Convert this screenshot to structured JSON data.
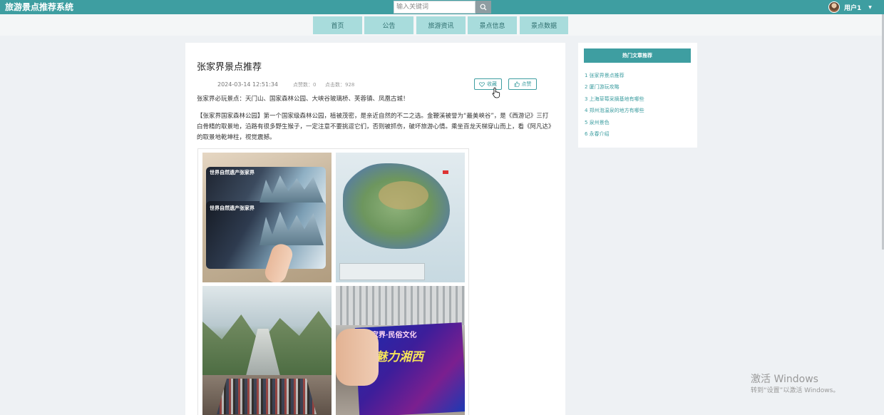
{
  "app": {
    "title": "旅游景点推荐系统"
  },
  "search": {
    "placeholder": "输入关键词"
  },
  "user": {
    "name": "用户1"
  },
  "nav": {
    "items": [
      "首页",
      "公告",
      "旅游资讯",
      "景点信息",
      "景点数据"
    ]
  },
  "article": {
    "title": "张家界景点推荐",
    "time": "2024-03-14 12:51:34",
    "favorites": "点赞数：0",
    "clicks": "点击数：928",
    "fav_button": "收藏",
    "like_button": "点赞",
    "intro": "张家界必玩景点：天门山、国家森林公园、大峡谷玻璃桥、芙蓉镇、凤凰古城！",
    "para2": "【张家界国家森林公园】第一个国家级森林公园，植被茂密，是亲近自然的不二之选。金鞭溪被誉为“最美峡谷”，是《西游记》三打白骨精的取景地，沿路有很多野生猴子，一定注意不要挑逗它们，否则被抓伤，破坏旅游心情。乘坐百龙天梯穿山而上，看《阿凡达》的取景地乾坤柱，视觉震撼。"
  },
  "gallery": {
    "ticket_text": "世界自然遗产张家界",
    "show_text": "张家界·民俗文化",
    "show_title": "魅力湘西"
  },
  "sidebar": {
    "title": "热门文章推荐",
    "items": [
      "1  张家界景点推荐",
      "2  厦门游玩攻略",
      "3  上海草莓采摘基地有哪些",
      "4  郑州泡温泉的地方有哪些",
      "5  泉州景色",
      "6  永春介绍"
    ]
  },
  "windows": {
    "line1": "激活 Windows",
    "line2": "转到“设置”以激活 Windows。"
  },
  "colors": {
    "accent": "#3e9ea1",
    "nav_bg": "#a8dcdc",
    "page_bg": "#eef1f4"
  }
}
